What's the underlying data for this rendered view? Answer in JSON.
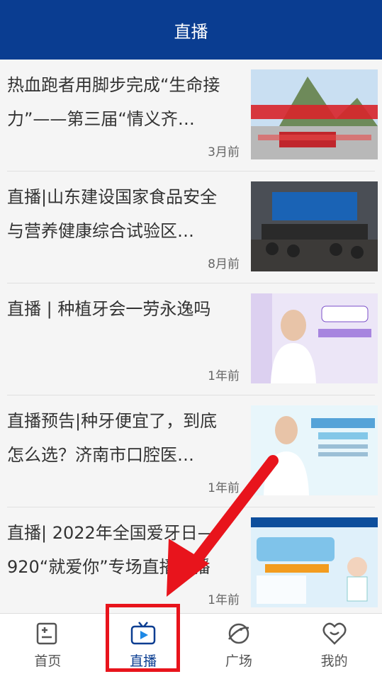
{
  "header": {
    "title": "直播"
  },
  "items": [
    {
      "title": "热血跑者用脚步完成“生命接力”——第三届“情义齐…",
      "time": "3月前"
    },
    {
      "title": "直播|山东建设国家食品安全与营养健康综合试验区…",
      "time": "8月前"
    },
    {
      "title": "直播 | 种植牙会一劳永逸吗",
      "time": "1年前"
    },
    {
      "title": "直播预告|种牙便宜了，到底怎么选？济南市口腔医…",
      "time": "1年前"
    },
    {
      "title": "直播| 2022年全国爱牙日—920“就爱你”专场直播联播",
      "time": "1年前"
    }
  ],
  "tabbar": {
    "tabs": [
      {
        "label": "首页",
        "icon": "home-icon"
      },
      {
        "label": "直播",
        "icon": "tv-icon"
      },
      {
        "label": "广场",
        "icon": "planet-icon"
      },
      {
        "label": "我的",
        "icon": "heart-smile-icon"
      }
    ],
    "active_index": 1
  },
  "colors": {
    "header_bg": "#0a3d91",
    "active": "#0a3d91",
    "annotation": "#e8141c"
  }
}
